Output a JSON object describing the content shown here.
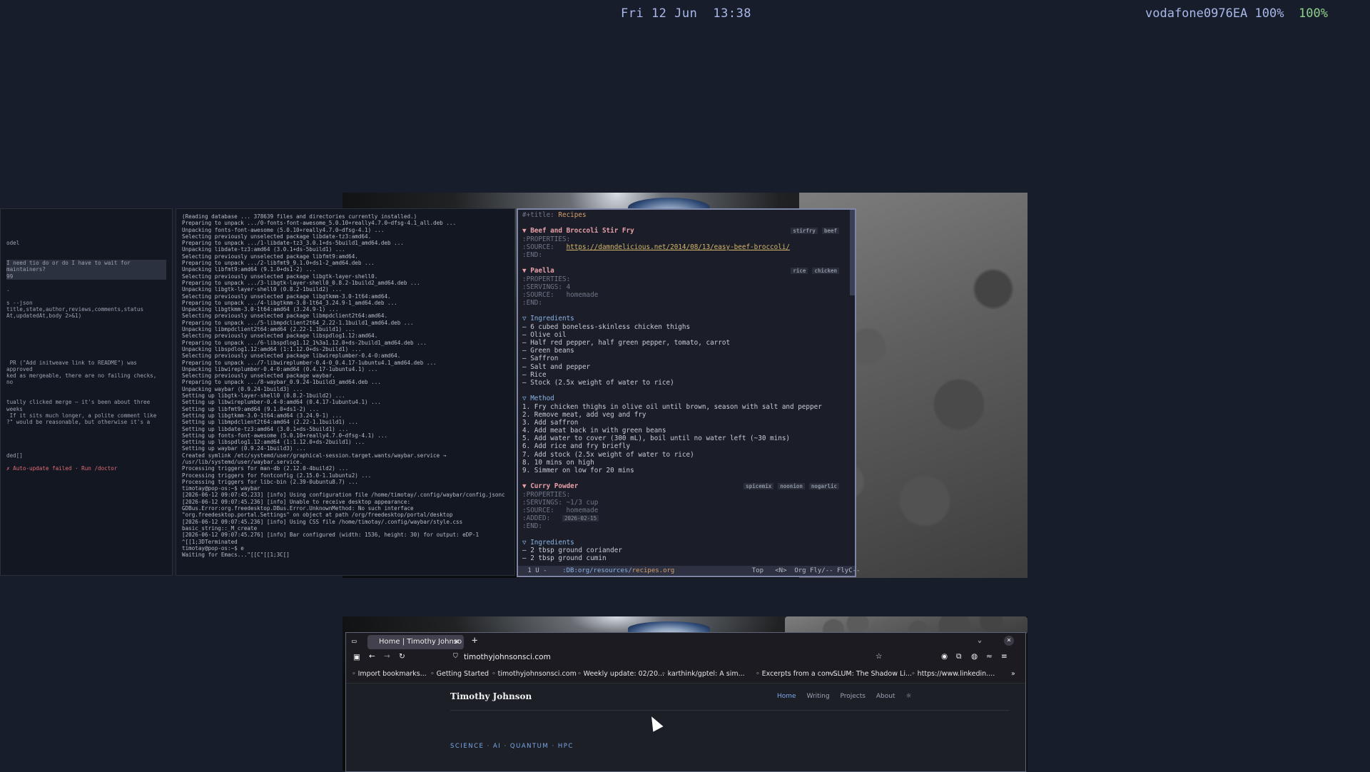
{
  "topbar": {
    "date": "Fri 12 Jun",
    "time": "13:38",
    "network": "vodafone0976EA 100%",
    "battery": "100%"
  },
  "left_terminal": {
    "lines": [
      "",
      "",
      "",
      "",
      "odel",
      "",
      "",
      "I need tio do or do I have to wait for maintainers?",
      "99",
      "",
      ".",
      "",
      "s --json title,state,author,reviews,comments,status",
      "At,updatedAt,body 2>&1)",
      "",
      "",
      "",
      "",
      "",
      "",
      " PR (\"Add initweave link to README\") was approved",
      "ked as mergeable, there are no failing checks, no",
      "",
      "",
      "tually clicked merge — it's been about three weeks",
      " If it sits much longer, a polite comment like",
      "?\" would be reasonable, but otherwise it's a",
      "",
      "",
      "",
      "",
      "ded[]",
      "",
      "✗ Auto-update failed · Run /doctor"
    ]
  },
  "apt_terminal": {
    "lines": [
      "(Reading database ... 378639 files and directories currently installed.)",
      "Preparing to unpack .../0-fonts-font-awesome_5.0.10+really4.7.0~dfsg-4.1_all.deb ...",
      "Unpacking fonts-font-awesome (5.0.10+really4.7.0~dfsg-4.1) ...",
      "Selecting previously unselected package libdate-tz3:amd64.",
      "Preparing to unpack .../1-libdate-tz3_3.0.1+ds-5build1_amd64.deb ...",
      "Unpacking libdate-tz3:amd64 (3.0.1+ds-5build1) ...",
      "Selecting previously unselected package libfmt9:amd64.",
      "Preparing to unpack .../2-libfmt9_9.1.0+ds1-2_amd64.deb ...",
      "Unpacking libfmt9:amd64 (9.1.0+ds1-2) ...",
      "Selecting previously unselected package libgtk-layer-shell0.",
      "Preparing to unpack .../3-libgtk-layer-shell0_0.8.2-1build2_amd64.deb ...",
      "Unpacking libgtk-layer-shell0 (0.8.2-1build2) ...",
      "Selecting previously unselected package libgtkmm-3.0-1t64:amd64.",
      "Preparing to unpack .../4-libgtkmm-3.0-1t64_3.24.9-1_amd64.deb ...",
      "Unpacking libgtkmm-3.0-1t64:amd64 (3.24.9-1) ...",
      "Selecting previously unselected package libmpdclient2t64:amd64.",
      "Preparing to unpack .../5-libmpdclient2t64_2.22-1.1build1_amd64.deb ...",
      "Unpacking libmpdclient2t64:amd64 (2.22-1.1build1) ...",
      "Selecting previously unselected package libspdlog1.12:amd64.",
      "Preparing to unpack .../6-libspdlog1.12_1%3a1.12.0+ds-2build1_amd64.deb ...",
      "Unpacking libspdlog1.12:amd64 (1:1.12.0+ds-2build1) ...",
      "Selecting previously unselected package libwireplumber-0.4-0:amd64.",
      "Preparing to unpack .../7-libwireplumber-0.4-0_0.4.17-1ubuntu4.1_amd64.deb ...",
      "Unpacking libwireplumber-0.4-0:amd64 (0.4.17-1ubuntu4.1) ...",
      "Selecting previously unselected package waybar.",
      "Preparing to unpack .../8-waybar_0.9.24-1build3_amd64.deb ...",
      "Unpacking waybar (0.9.24-1build3) ...",
      "Setting up libgtk-layer-shell0 (0.8.2-1build2) ...",
      "Setting up libwireplumber-0.4-0:amd64 (0.4.17-1ubuntu4.1) ...",
      "Setting up libfmt9:amd64 (9.1.0+ds1-2) ...",
      "Setting up libgtkmm-3.0-1t64:amd64 (3.24.9-1) ...",
      "Setting up libmpdclient2t64:amd64 (2.22-1.1build1) ...",
      "Setting up libdate-tz3:amd64 (3.0.1+ds-5build1) ...",
      "Setting up fonts-font-awesome (5.0.10+really4.7.0~dfsg-4.1) ...",
      "Setting up libspdlog1.12:amd64 (1:1.12.0+ds-2build1) ...",
      "Setting up waybar (0.9.24-1build3) ...",
      "Created symlink /etc/systemd/user/graphical-session.target.wants/waybar.service → /usr/lib/systemd/user/waybar.service.",
      "Processing triggers for man-db (2.12.0-4build2) ...",
      "Processing triggers for fontconfig (2.15.0-1.1ubuntu2) ...",
      "Processing triggers for libc-bin (2.39-0ubuntu8.7) ...",
      "timotay@pop-os:~$ waybar",
      "[2026-06-12 09:07:45.233] [info] Using configuration file /home/timotay/.config/waybar/config.jsonc",
      "[2026-06-12 09:07:45.236] [info] Unable to receive desktop appearance: GDBus.Error:org.freedesktop.DBus.Error.UnknownMethod: No such interface \"org.freedesktop.portal.Settings\" on object at path /org/freedesktop/portal/desktop",
      "[2026-06-12 09:07:45.236] [info] Using CSS file /home/timotay/.config/waybar/style.css",
      "basic_string::_M_create",
      "[2026-06-12 09:07:45.276] [info] Bar configured (width: 1536, height: 30) for output: eDP-1",
      "^[[1;3DTerminated",
      "timotay@pop-os:~$ e",
      "Waiting for Emacs...\"[[C\"[[1;3C[]"
    ]
  },
  "emacs": {
    "title_key": "#+title:",
    "title_val": "Recipes",
    "recipes": [
      {
        "heading": "Beef and Broccoli Stir Fry",
        "tags": [
          "stirfry",
          "beef"
        ],
        "properties": [
          ":PROPERTIES:",
          ":SOURCE:   "
        ],
        "link": "https://damndelicious.net/2014/08/13/easy-beef-broccoli/",
        "end": ":END:"
      },
      {
        "heading": "Paella",
        "tags": [
          "rice",
          "chicken"
        ],
        "properties": [
          ":PROPERTIES:",
          ":SERVINGS: 4",
          ":SOURCE:   homemade"
        ],
        "end": ":END:",
        "ingredients_label": "Ingredients",
        "ingredients": [
          "— 6 cubed boneless-skinless chicken thighs",
          "— Olive oil",
          "— Half red pepper, half green pepper, tomato, carrot",
          "— Green beans",
          "— Saffron",
          "— Salt and pepper",
          "— Rice",
          "— Stock (2.5x weight of water to rice)"
        ],
        "method_label": "Method",
        "method": [
          "1. Fry chicken thighs in olive oil until brown, season with salt and pepper",
          "2. Remove meat, add veg and fry",
          "3. Add saffron",
          "4. Add meat back in with green beans",
          "5. Add water to cover (300 mL), boil until no water left (~30 mins)",
          "6. Add rice and fry briefly",
          "7. Add stock (2.5x weight of water to rice)",
          "8. 10 mins on high",
          "9. Simmer on low for 20 mins"
        ]
      },
      {
        "heading": "Curry Powder",
        "tags": [
          "spicemix",
          "noonion",
          "nogarlic"
        ],
        "properties": [
          ":PROPERTIES:",
          ":SERVINGS: ~1/3 cup",
          ":SOURCE:   homemade"
        ],
        "added_key": ":ADDED:   ",
        "added_val": "2026-02-15",
        "end": ":END:",
        "ingredients_label": "Ingredients",
        "ingredients": [
          "— 2 tbsp ground coriander",
          "— 2 tbsp ground cumin"
        ]
      }
    ],
    "modeline": {
      "left": " 1 U -",
      "path_dir": ":DB:org/resources/",
      "file": "recipes.org",
      "right": "Top   <N>  Org Fly/-- FlyC--"
    }
  },
  "firefox": {
    "tab_title": "Home | Timothy Johnso",
    "url": "timothyjohnsonsci.com",
    "bookmarks": [
      "Import bookmarks...",
      "Getting Started",
      "timothyjohnsonsci.com",
      "Weekly update: 02/20...",
      "karthink/gptel: A sim...",
      "Excerpts from a conv...",
      "SLUM: The Shadow Li...",
      "https://www.linkedin...."
    ],
    "site": {
      "name": "Timothy Johnson",
      "nav": [
        "Home",
        "Writing",
        "Projects",
        "About"
      ],
      "kicker": "SCIENCE · AI · QUANTUM · HPC"
    }
  }
}
